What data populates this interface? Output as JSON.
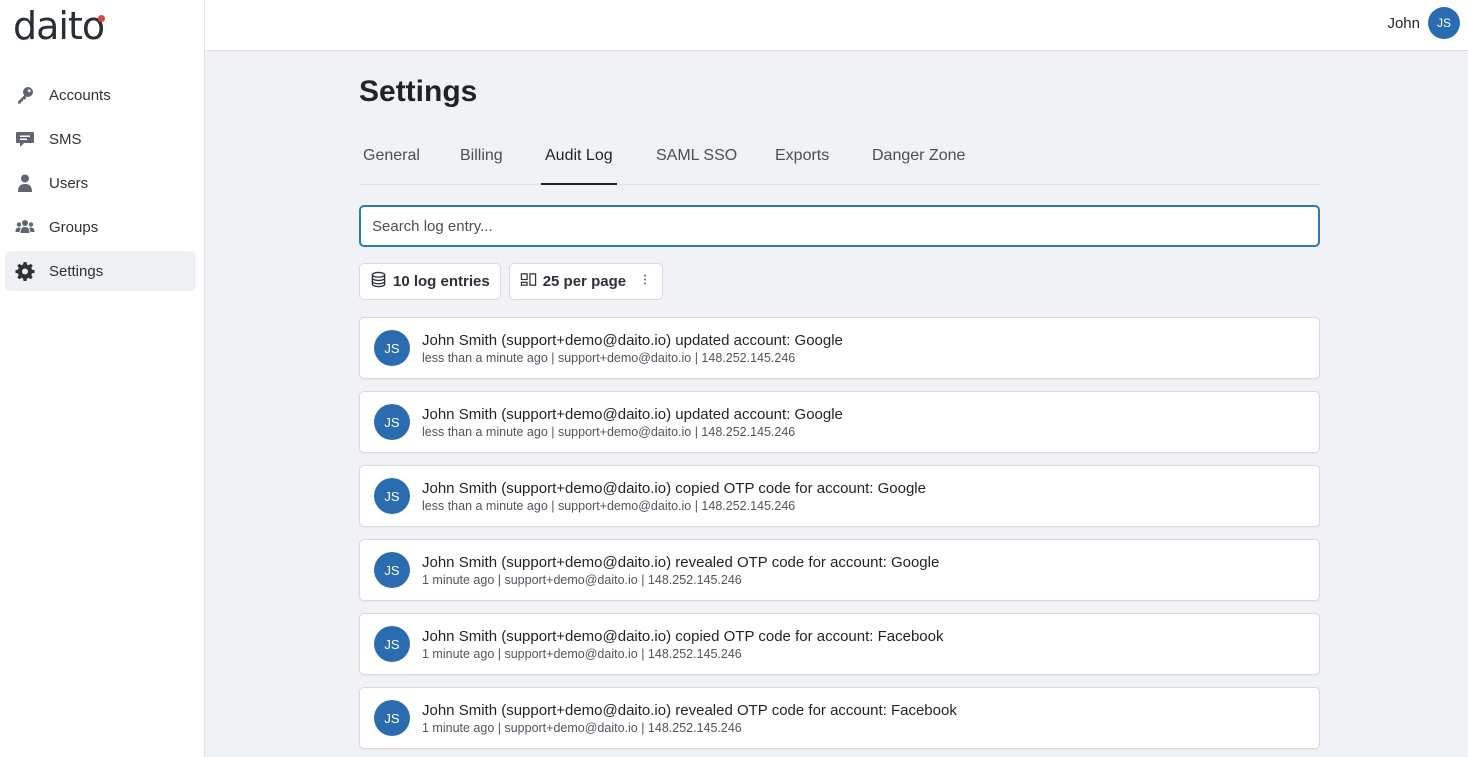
{
  "brand": {
    "name_prefix": "dait",
    "name_o": "o",
    "accent": "#e0463e"
  },
  "sidebar": {
    "items": [
      {
        "label": "Accounts",
        "icon": "key-icon"
      },
      {
        "label": "SMS",
        "icon": "message-icon"
      },
      {
        "label": "Users",
        "icon": "user-icon"
      },
      {
        "label": "Groups",
        "icon": "users-icon"
      },
      {
        "label": "Settings",
        "icon": "gear-icon",
        "active": true
      }
    ]
  },
  "header": {
    "user_name": "John",
    "user_initials": "JS"
  },
  "main": {
    "title": "Settings",
    "tabs": [
      {
        "label": "General"
      },
      {
        "label": "Billing"
      },
      {
        "label": "Audit Log",
        "active": true
      },
      {
        "label": "SAML SSO"
      },
      {
        "label": "Exports"
      },
      {
        "label": "Danger Zone"
      }
    ],
    "search": {
      "placeholder": "Search log entry...",
      "value": ""
    },
    "chips": {
      "count_label": "10 log entries",
      "per_page_label": "25 per page"
    },
    "entries": [
      {
        "initials": "JS",
        "text": "John Smith (support+demo@daito.io) updated account: Google",
        "meta": "less than a minute ago | support+demo@daito.io | 148.252.145.246"
      },
      {
        "initials": "JS",
        "text": "John Smith (support+demo@daito.io) updated account: Google",
        "meta": "less than a minute ago | support+demo@daito.io | 148.252.145.246"
      },
      {
        "initials": "JS",
        "text": "John Smith (support+demo@daito.io) copied OTP code for account: Google",
        "meta": "less than a minute ago | support+demo@daito.io | 148.252.145.246"
      },
      {
        "initials": "JS",
        "text": "John Smith (support+demo@daito.io) revealed OTP code for account: Google",
        "meta": "1 minute ago | support+demo@daito.io | 148.252.145.246"
      },
      {
        "initials": "JS",
        "text": "John Smith (support+demo@daito.io) copied OTP code for account: Facebook",
        "meta": "1 minute ago | support+demo@daito.io | 148.252.145.246"
      },
      {
        "initials": "JS",
        "text": "John Smith (support+demo@daito.io) revealed OTP code for account: Facebook",
        "meta": "1 minute ago | support+demo@daito.io | 148.252.145.246"
      }
    ]
  },
  "colors": {
    "avatar": "#2b6cb0",
    "focus": "#2b7cb3"
  }
}
